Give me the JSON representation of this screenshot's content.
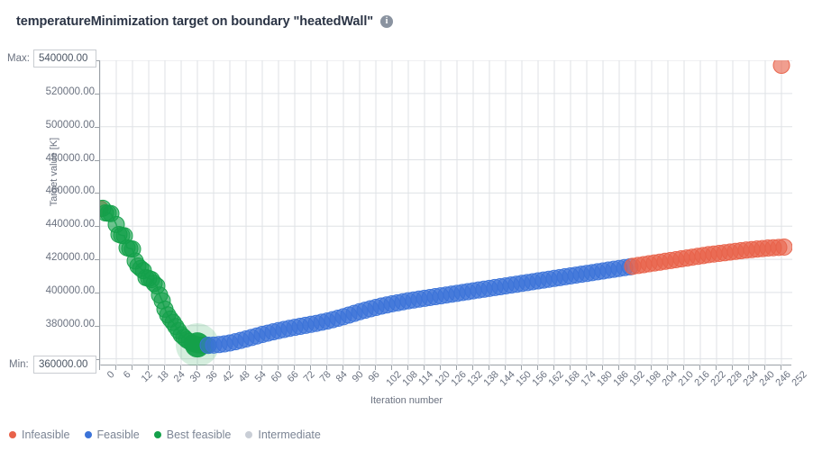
{
  "header": {
    "title": "temperatureMinimization target on boundary \"heatedWall\"",
    "info_icon": "info-icon"
  },
  "axis_controls": {
    "max_label": "Max:",
    "max_value": "540000.00",
    "min_label": "Min:",
    "min_value": "360000.00"
  },
  "legend": {
    "items": [
      {
        "label": "Infeasible",
        "color": "#e8624a",
        "name": "legend-item-infeasible"
      },
      {
        "label": "Feasible",
        "color": "#3b73d8",
        "name": "legend-item-feasible"
      },
      {
        "label": "Best feasible",
        "color": "#14a04a",
        "name": "legend-item-best-feasible"
      },
      {
        "label": "Intermediate",
        "color": "#c9ced6",
        "name": "legend-item-intermediate"
      }
    ]
  },
  "chart_data": {
    "type": "scatter",
    "title": "temperatureMinimization target on boundary \"heatedWall\"",
    "xlabel": "Iteration number",
    "ylabel": "Target value [K]",
    "xlim": [
      0,
      256
    ],
    "ylim": [
      356000,
      540000
    ],
    "grid": true,
    "legend_position": "bottom-left",
    "yticks": [
      360000,
      380000,
      400000,
      420000,
      440000,
      460000,
      480000,
      500000,
      520000,
      540000
    ],
    "ytick_labels": [
      "360000.00",
      "380000.00",
      "400000.00",
      "420000.00",
      "440000.00",
      "460000.00",
      "480000.00",
      "500000.00",
      "520000.00",
      "540000.00"
    ],
    "xticks": [
      0,
      6,
      12,
      18,
      24,
      30,
      36,
      42,
      48,
      54,
      60,
      66,
      72,
      78,
      84,
      90,
      96,
      102,
      108,
      114,
      120,
      126,
      132,
      138,
      144,
      150,
      156,
      162,
      168,
      174,
      180,
      186,
      192,
      198,
      204,
      210,
      216,
      222,
      228,
      234,
      240,
      246,
      252
    ],
    "marker_radius": 9,
    "best_marker_radius": 14,
    "colors": {
      "infeasible": "#e8624a",
      "feasible": "#3b73d8",
      "best_feasible": "#14a04a",
      "intermediate": "#c9ced6",
      "grid": "#dfe2e6",
      "axis": "#9aa0a6"
    },
    "series": [
      {
        "name": "Infeasible",
        "color": "#e8624a",
        "points": [
          [
            0,
            450500
          ],
          [
            252,
            537000
          ]
        ]
      },
      {
        "name": "Best feasible",
        "color": "#14a04a",
        "points": [
          [
            1,
            450800
          ],
          [
            2,
            448000
          ],
          [
            3,
            447800
          ],
          [
            4,
            447600
          ],
          [
            6,
            441000
          ],
          [
            7,
            435000
          ],
          [
            8,
            434500
          ],
          [
            9,
            434200
          ],
          [
            10,
            427000
          ],
          [
            11,
            426500
          ],
          [
            12,
            426200
          ],
          [
            13,
            419000
          ],
          [
            14,
            416000
          ],
          [
            15,
            414500
          ],
          [
            16,
            413200
          ],
          [
            17,
            409000
          ],
          [
            18,
            408500
          ],
          [
            19,
            407800
          ],
          [
            20,
            405500
          ],
          [
            21,
            404000
          ],
          [
            22,
            398500
          ],
          [
            23,
            395000
          ],
          [
            24,
            390000
          ],
          [
            25,
            386500
          ],
          [
            26,
            384000
          ],
          [
            27,
            382000
          ],
          [
            28,
            379500
          ],
          [
            29,
            377000
          ],
          [
            30,
            374500
          ],
          [
            31,
            373000
          ],
          [
            32,
            371500
          ],
          [
            33,
            370500
          ],
          [
            34,
            369500
          ],
          [
            35,
            369000
          ],
          [
            36,
            368500
          ],
          [
            37,
            368300
          ],
          [
            38,
            368200
          ],
          [
            39,
            368150
          ],
          [
            40,
            368100
          ]
        ]
      },
      {
        "name": "Best feasible point",
        "color": "#14a04a",
        "highlight": true,
        "points": [
          [
            36,
            368400
          ]
        ]
      },
      {
        "name": "Feasible",
        "color": "#3b73d8",
        "points": [
          [
            40,
            368200
          ],
          [
            42,
            368300
          ],
          [
            44,
            368600
          ],
          [
            46,
            369000
          ],
          [
            48,
            369600
          ],
          [
            50,
            370300
          ],
          [
            52,
            371100
          ],
          [
            54,
            372000
          ],
          [
            56,
            372900
          ],
          [
            58,
            373800
          ],
          [
            60,
            374700
          ],
          [
            62,
            375500
          ],
          [
            64,
            376300
          ],
          [
            66,
            377000
          ],
          [
            68,
            377700
          ],
          [
            70,
            378400
          ],
          [
            72,
            379000
          ],
          [
            74,
            379600
          ],
          [
            76,
            380200
          ],
          [
            78,
            380800
          ],
          [
            80,
            381400
          ],
          [
            82,
            382100
          ],
          [
            84,
            382800
          ],
          [
            86,
            383600
          ],
          [
            88,
            384500
          ],
          [
            90,
            385400
          ],
          [
            92,
            386400
          ],
          [
            94,
            387400
          ],
          [
            96,
            388400
          ],
          [
            98,
            389300
          ],
          [
            100,
            390200
          ],
          [
            102,
            391000
          ],
          [
            104,
            391800
          ],
          [
            106,
            392500
          ],
          [
            108,
            393200
          ],
          [
            110,
            393800
          ],
          [
            112,
            394400
          ],
          [
            114,
            395000
          ],
          [
            116,
            395500
          ],
          [
            118,
            396000
          ],
          [
            120,
            396500
          ],
          [
            122,
            397000
          ],
          [
            124,
            397500
          ],
          [
            126,
            398000
          ],
          [
            128,
            398500
          ],
          [
            130,
            399000
          ],
          [
            132,
            399500
          ],
          [
            134,
            400000
          ],
          [
            136,
            400500
          ],
          [
            138,
            401000
          ],
          [
            140,
            401500
          ],
          [
            142,
            402000
          ],
          [
            144,
            402500
          ],
          [
            146,
            403000
          ],
          [
            148,
            403500
          ],
          [
            150,
            404000
          ],
          [
            152,
            404500
          ],
          [
            154,
            405000
          ],
          [
            156,
            405500
          ],
          [
            158,
            406000
          ],
          [
            160,
            406500
          ],
          [
            162,
            407000
          ],
          [
            164,
            407500
          ],
          [
            166,
            408000
          ],
          [
            168,
            408500
          ],
          [
            170,
            409000
          ],
          [
            172,
            409500
          ],
          [
            174,
            410000
          ],
          [
            176,
            410500
          ],
          [
            178,
            411000
          ],
          [
            180,
            411500
          ],
          [
            182,
            412000
          ],
          [
            184,
            412500
          ],
          [
            186,
            413000
          ],
          [
            188,
            413500
          ],
          [
            190,
            414000
          ],
          [
            192,
            414500
          ],
          [
            194,
            415000
          ],
          [
            196,
            415500
          ]
        ]
      },
      {
        "name": "Infeasible tail",
        "color": "#e8624a",
        "points": [
          [
            197,
            415800
          ],
          [
            199,
            416300
          ],
          [
            201,
            416800
          ],
          [
            203,
            417300
          ],
          [
            205,
            417800
          ],
          [
            207,
            418300
          ],
          [
            209,
            418800
          ],
          [
            211,
            419300
          ],
          [
            213,
            419800
          ],
          [
            215,
            420300
          ],
          [
            217,
            420800
          ],
          [
            219,
            421300
          ],
          [
            221,
            421800
          ],
          [
            223,
            422300
          ],
          [
            225,
            422800
          ],
          [
            227,
            423200
          ],
          [
            229,
            423600
          ],
          [
            231,
            424000
          ],
          [
            233,
            424400
          ],
          [
            235,
            424800
          ],
          [
            237,
            425200
          ],
          [
            239,
            425600
          ],
          [
            241,
            425900
          ],
          [
            243,
            426200
          ],
          [
            245,
            426500
          ],
          [
            247,
            426800
          ],
          [
            249,
            427000
          ],
          [
            251,
            427200
          ],
          [
            253,
            427400
          ]
        ]
      }
    ]
  }
}
